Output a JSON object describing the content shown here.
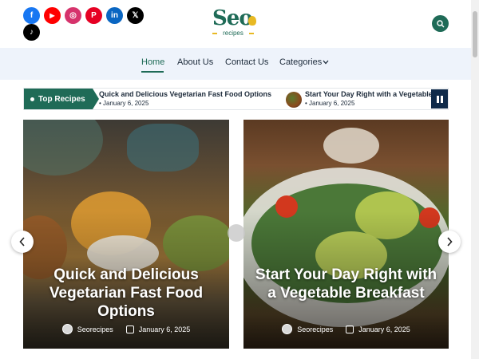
{
  "header": {
    "socials": [
      {
        "name": "facebook-icon",
        "glyph": "f",
        "color": "#1877f2"
      },
      {
        "name": "youtube-icon",
        "glyph": "▶",
        "color": "#ff0000"
      },
      {
        "name": "instagram-icon",
        "glyph": "◎",
        "color": "#d6336c"
      },
      {
        "name": "pinterest-icon",
        "glyph": "P",
        "color": "#e60023"
      },
      {
        "name": "linkedin-icon",
        "glyph": "in",
        "color": "#0a66c2"
      },
      {
        "name": "x-icon",
        "glyph": "𝕏",
        "color": "#000000"
      },
      {
        "name": "tiktok-icon",
        "glyph": "♪",
        "color": "#000000"
      }
    ],
    "logo": {
      "main": "Seo",
      "sub": "recipes"
    }
  },
  "nav": {
    "items": [
      "Home",
      "About Us",
      "Contact Us",
      "Categories"
    ]
  },
  "ticker": {
    "label": "Top Recipes",
    "items": [
      {
        "title": "Quick and Delicious Vegetarian Fast Food Options",
        "date": "January 6, 2025"
      },
      {
        "title": "Start Your Day Right with a Vegetable Breakfast",
        "date": "January 6, 2025"
      }
    ]
  },
  "posts": [
    {
      "title": "Quick and Delicious Vegetarian Fast Food Options",
      "author": "Seorecipes",
      "date": "January 6, 2025"
    },
    {
      "title": "Start Your Day Right with a Vegetable Breakfast",
      "author": "Seorecipes",
      "date": "January 6, 2025"
    }
  ],
  "colors": {
    "accent": "#1f6b57",
    "navy": "#0f2a4a",
    "nav_bg": "#eef3fb"
  }
}
